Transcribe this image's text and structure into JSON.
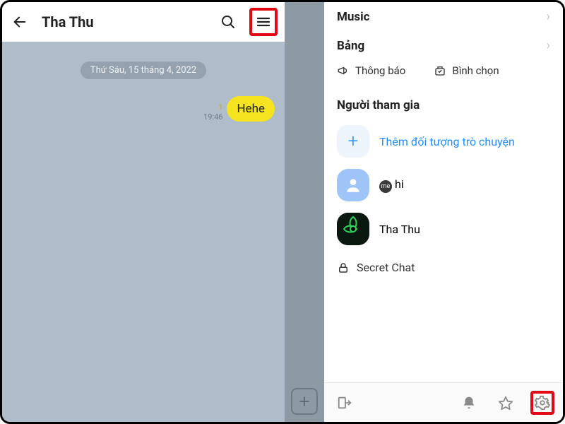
{
  "chat": {
    "title": "Tha Thu",
    "date": "Thứ Sáu, 15 tháng 4, 2022",
    "message": {
      "text": "Hehe",
      "time": "19:46",
      "unread": "1"
    }
  },
  "menu": {
    "music": "Music",
    "bang": "Bảng",
    "notify": "Thông báo",
    "vote": "Bình chọn",
    "participants_title": "Người tham gia",
    "add_participant": "Thêm đối tượng trò chuyện",
    "me_badge": "me",
    "me_name": "hi",
    "other_name": "Tha Thu",
    "secret_chat": "Secret Chat"
  }
}
